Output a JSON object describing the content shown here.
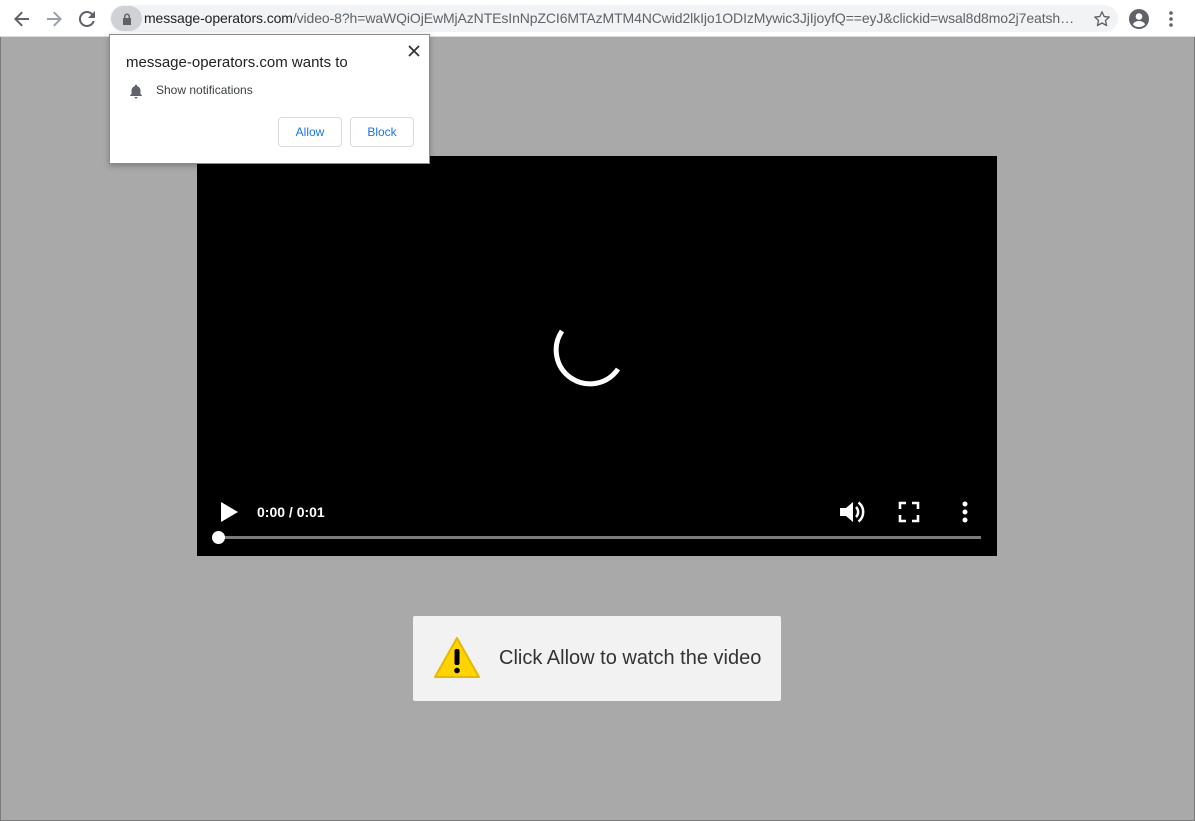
{
  "browser": {
    "url_host": "message-operators.com",
    "url_path": "/video-8?h=waWQiOjEwMjAzNTEsInNpZCI6MTAzMTM4NCwid2lkIjo1ODIzMywic3JjIjoyfQ==eyJ&clickid=wsal8d8mo2j7eatsh…"
  },
  "prompt": {
    "title": "message-operators.com wants to",
    "permission": "Show notifications",
    "allow_label": "Allow",
    "block_label": "Block"
  },
  "video": {
    "time": "0:00 / 0:01",
    "progress": 0
  },
  "alert": {
    "text": "Click Allow to watch the video"
  },
  "colors": {
    "page_bg": "#a9a9a9",
    "accent": "#1a73e8",
    "warning": "#ffd400"
  },
  "icons": {
    "back": "back-arrow-icon",
    "forward": "forward-arrow-icon",
    "reload": "reload-icon",
    "lock": "lock-icon",
    "star": "star-icon",
    "profile": "profile-icon",
    "menu": "kebab-menu-icon",
    "warning": "warning-icon"
  }
}
